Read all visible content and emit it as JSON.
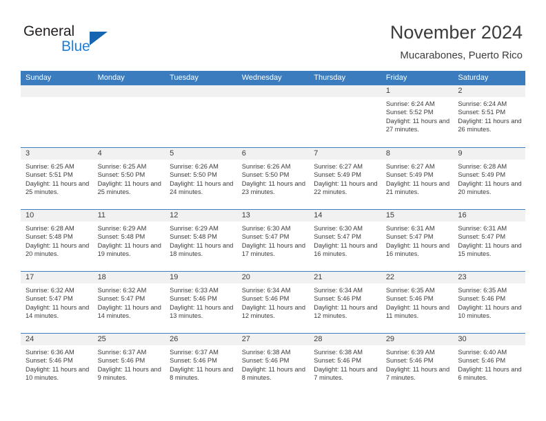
{
  "logo": {
    "word_one": "General",
    "word_two": "Blue",
    "triangle_color": "#1565b0",
    "blue_color": "#1f7fd4"
  },
  "header": {
    "month_title": "November 2024",
    "location": "Mucarabones, Puerto Rico"
  },
  "theme": {
    "header_blue": "#3a7cbe",
    "day_strip_gray": "#f1f1f1",
    "text_color": "#3b3b3b"
  },
  "weekday_headers": [
    "Sunday",
    "Monday",
    "Tuesday",
    "Wednesday",
    "Thursday",
    "Friday",
    "Saturday"
  ],
  "weeks": [
    [
      {
        "day": "",
        "lines": []
      },
      {
        "day": "",
        "lines": []
      },
      {
        "day": "",
        "lines": []
      },
      {
        "day": "",
        "lines": []
      },
      {
        "day": "",
        "lines": []
      },
      {
        "day": "1",
        "lines": [
          "Sunrise: 6:24 AM",
          "Sunset: 5:52 PM",
          "Daylight: 11 hours and 27 minutes."
        ]
      },
      {
        "day": "2",
        "lines": [
          "Sunrise: 6:24 AM",
          "Sunset: 5:51 PM",
          "Daylight: 11 hours and 26 minutes."
        ]
      }
    ],
    [
      {
        "day": "3",
        "lines": [
          "Sunrise: 6:25 AM",
          "Sunset: 5:51 PM",
          "Daylight: 11 hours and 25 minutes."
        ]
      },
      {
        "day": "4",
        "lines": [
          "Sunrise: 6:25 AM",
          "Sunset: 5:50 PM",
          "Daylight: 11 hours and 25 minutes."
        ]
      },
      {
        "day": "5",
        "lines": [
          "Sunrise: 6:26 AM",
          "Sunset: 5:50 PM",
          "Daylight: 11 hours and 24 minutes."
        ]
      },
      {
        "day": "6",
        "lines": [
          "Sunrise: 6:26 AM",
          "Sunset: 5:50 PM",
          "Daylight: 11 hours and 23 minutes."
        ]
      },
      {
        "day": "7",
        "lines": [
          "Sunrise: 6:27 AM",
          "Sunset: 5:49 PM",
          "Daylight: 11 hours and 22 minutes."
        ]
      },
      {
        "day": "8",
        "lines": [
          "Sunrise: 6:27 AM",
          "Sunset: 5:49 PM",
          "Daylight: 11 hours and 21 minutes."
        ]
      },
      {
        "day": "9",
        "lines": [
          "Sunrise: 6:28 AM",
          "Sunset: 5:49 PM",
          "Daylight: 11 hours and 20 minutes."
        ]
      }
    ],
    [
      {
        "day": "10",
        "lines": [
          "Sunrise: 6:28 AM",
          "Sunset: 5:48 PM",
          "Daylight: 11 hours and 20 minutes."
        ]
      },
      {
        "day": "11",
        "lines": [
          "Sunrise: 6:29 AM",
          "Sunset: 5:48 PM",
          "Daylight: 11 hours and 19 minutes."
        ]
      },
      {
        "day": "12",
        "lines": [
          "Sunrise: 6:29 AM",
          "Sunset: 5:48 PM",
          "Daylight: 11 hours and 18 minutes."
        ]
      },
      {
        "day": "13",
        "lines": [
          "Sunrise: 6:30 AM",
          "Sunset: 5:47 PM",
          "Daylight: 11 hours and 17 minutes."
        ]
      },
      {
        "day": "14",
        "lines": [
          "Sunrise: 6:30 AM",
          "Sunset: 5:47 PM",
          "Daylight: 11 hours and 16 minutes."
        ]
      },
      {
        "day": "15",
        "lines": [
          "Sunrise: 6:31 AM",
          "Sunset: 5:47 PM",
          "Daylight: 11 hours and 16 minutes."
        ]
      },
      {
        "day": "16",
        "lines": [
          "Sunrise: 6:31 AM",
          "Sunset: 5:47 PM",
          "Daylight: 11 hours and 15 minutes."
        ]
      }
    ],
    [
      {
        "day": "17",
        "lines": [
          "Sunrise: 6:32 AM",
          "Sunset: 5:47 PM",
          "Daylight: 11 hours and 14 minutes."
        ]
      },
      {
        "day": "18",
        "lines": [
          "Sunrise: 6:32 AM",
          "Sunset: 5:47 PM",
          "Daylight: 11 hours and 14 minutes."
        ]
      },
      {
        "day": "19",
        "lines": [
          "Sunrise: 6:33 AM",
          "Sunset: 5:46 PM",
          "Daylight: 11 hours and 13 minutes."
        ]
      },
      {
        "day": "20",
        "lines": [
          "Sunrise: 6:34 AM",
          "Sunset: 5:46 PM",
          "Daylight: 11 hours and 12 minutes."
        ]
      },
      {
        "day": "21",
        "lines": [
          "Sunrise: 6:34 AM",
          "Sunset: 5:46 PM",
          "Daylight: 11 hours and 12 minutes."
        ]
      },
      {
        "day": "22",
        "lines": [
          "Sunrise: 6:35 AM",
          "Sunset: 5:46 PM",
          "Daylight: 11 hours and 11 minutes."
        ]
      },
      {
        "day": "23",
        "lines": [
          "Sunrise: 6:35 AM",
          "Sunset: 5:46 PM",
          "Daylight: 11 hours and 10 minutes."
        ]
      }
    ],
    [
      {
        "day": "24",
        "lines": [
          "Sunrise: 6:36 AM",
          "Sunset: 5:46 PM",
          "Daylight: 11 hours and 10 minutes."
        ]
      },
      {
        "day": "25",
        "lines": [
          "Sunrise: 6:37 AM",
          "Sunset: 5:46 PM",
          "Daylight: 11 hours and 9 minutes."
        ]
      },
      {
        "day": "26",
        "lines": [
          "Sunrise: 6:37 AM",
          "Sunset: 5:46 PM",
          "Daylight: 11 hours and 8 minutes."
        ]
      },
      {
        "day": "27",
        "lines": [
          "Sunrise: 6:38 AM",
          "Sunset: 5:46 PM",
          "Daylight: 11 hours and 8 minutes."
        ]
      },
      {
        "day": "28",
        "lines": [
          "Sunrise: 6:38 AM",
          "Sunset: 5:46 PM",
          "Daylight: 11 hours and 7 minutes."
        ]
      },
      {
        "day": "29",
        "lines": [
          "Sunrise: 6:39 AM",
          "Sunset: 5:46 PM",
          "Daylight: 11 hours and 7 minutes."
        ]
      },
      {
        "day": "30",
        "lines": [
          "Sunrise: 6:40 AM",
          "Sunset: 5:46 PM",
          "Daylight: 11 hours and 6 minutes."
        ]
      }
    ]
  ]
}
